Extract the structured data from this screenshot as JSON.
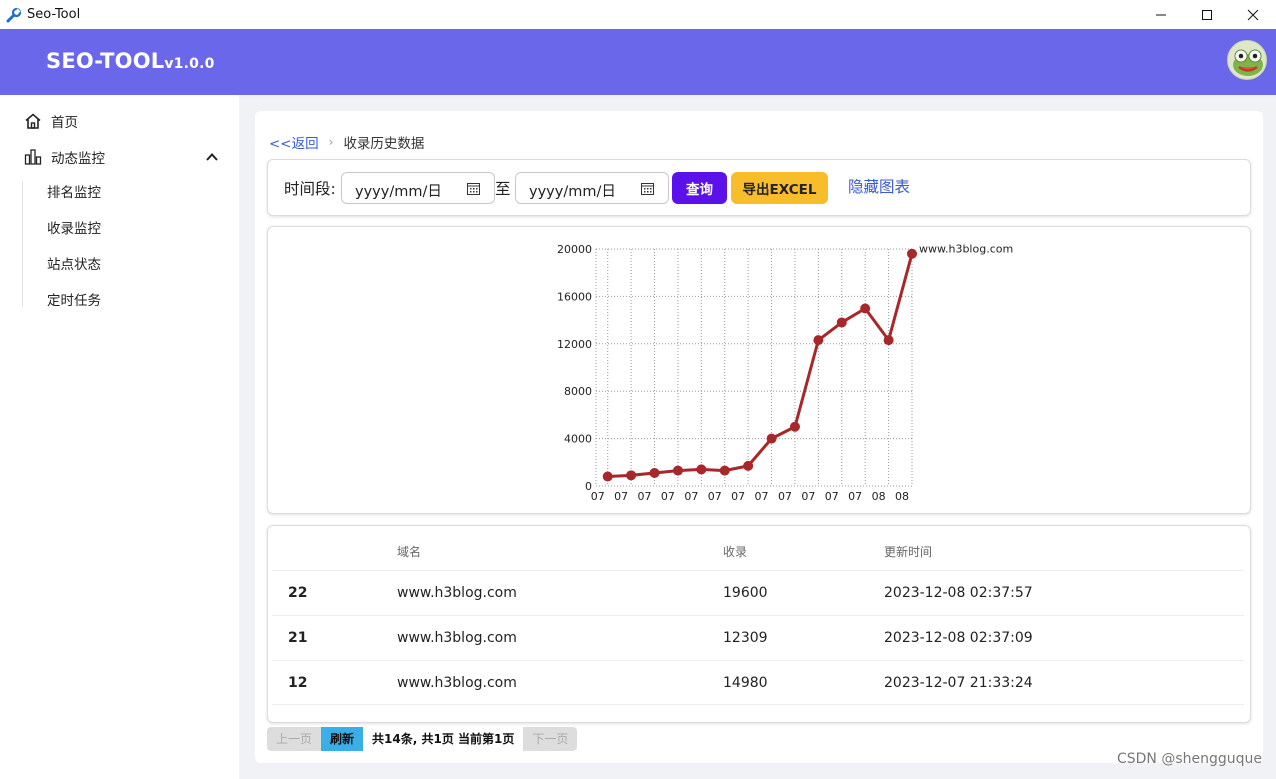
{
  "window": {
    "title": "Seo-Tool",
    "app_icon": "wrench-icon"
  },
  "header": {
    "brand": "SEO-TOOL",
    "version": "v1.0.0",
    "avatar_icon": "frog-avatar"
  },
  "sidebar": {
    "items": [
      {
        "label": "首页",
        "icon": "home-icon"
      },
      {
        "label": "动态监控",
        "icon": "chart-icon"
      }
    ],
    "sub_items": [
      "排名监控",
      "收录监控",
      "站点状态",
      "定时任务"
    ]
  },
  "breadcrumb": {
    "back": "<<返回",
    "current": "收录历史数据"
  },
  "filter": {
    "label": "时间段:",
    "start_placeholder": "yyyy/mm/日",
    "to": "至",
    "end_placeholder": "yyyy/mm/日",
    "query": "查询",
    "export": "导出EXCEL",
    "hide_chart": "隐藏图表"
  },
  "chart_data": {
    "type": "line",
    "categories": [
      "07",
      "07",
      "07",
      "07",
      "07",
      "07",
      "07",
      "07",
      "07",
      "07",
      "07",
      "07",
      "08",
      "08"
    ],
    "series": [
      {
        "name": "www.h3blog.com",
        "values": [
          800,
          900,
          1100,
          1300,
          1400,
          1300,
          1700,
          4000,
          5000,
          12309,
          13800,
          14980,
          12309,
          19600
        ]
      }
    ],
    "ylim": [
      0,
      20000
    ],
    "yticks": [
      "0",
      "4000",
      "8000",
      "12000",
      "16000",
      "20000"
    ],
    "grid": true,
    "line_color": "#a82729"
  },
  "table": {
    "headers": [
      "域名",
      "收录",
      "更新时间"
    ],
    "rows": [
      {
        "id": "22",
        "domain": "www.h3blog.com",
        "count": "19600",
        "time": "2023-12-08 02:37:57"
      },
      {
        "id": "21",
        "domain": "www.h3blog.com",
        "count": "12309",
        "time": "2023-12-08 02:37:09"
      },
      {
        "id": "12",
        "domain": "www.h3blog.com",
        "count": "14980",
        "time": "2023-12-07 21:33:24"
      }
    ]
  },
  "pager": {
    "prev": "上一页",
    "refresh": "刷新",
    "info": "共14条, 共1页 当前第1页",
    "next": "下一页"
  },
  "watermark": "CSDN @shengguque"
}
